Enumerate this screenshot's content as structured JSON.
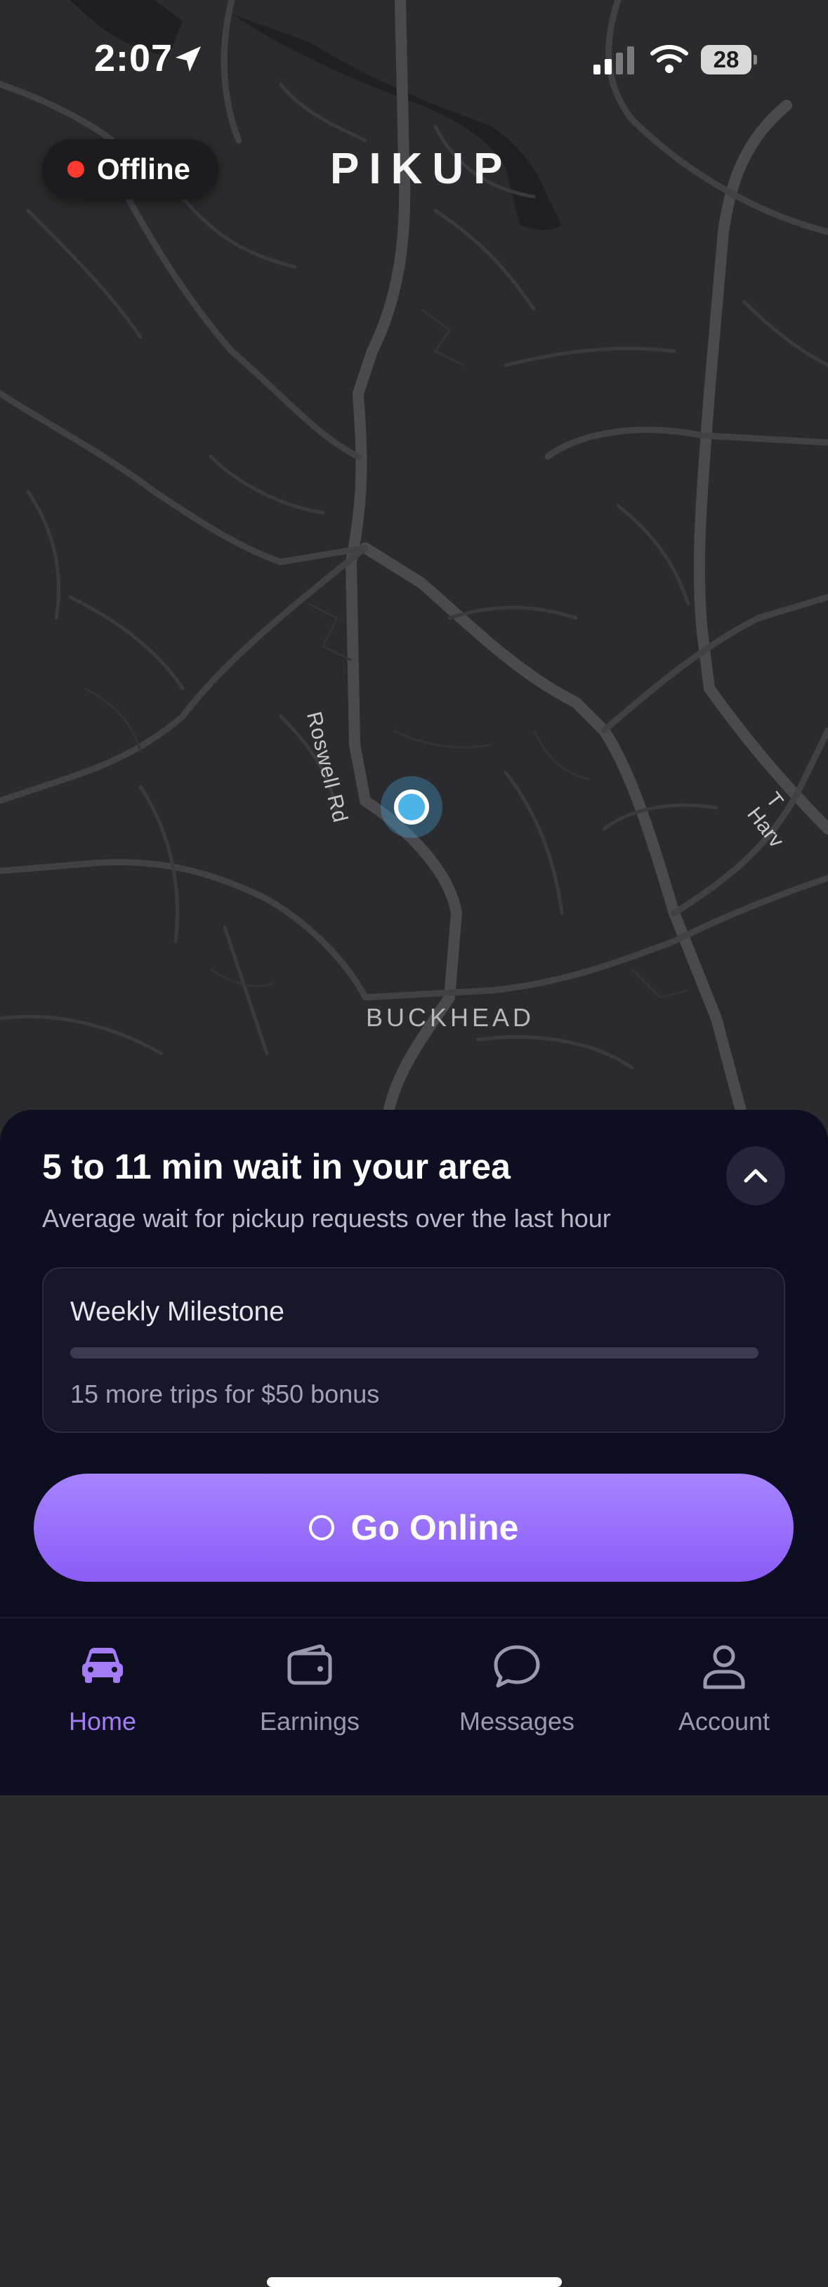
{
  "status_bar": {
    "time": "2:07",
    "battery": "28"
  },
  "header": {
    "status_label": "Offline",
    "status_color": "#ff3b30",
    "logo": "PIKUP"
  },
  "map": {
    "road_label": "Roswell Rd",
    "area_label": "BUCKHEAD",
    "edge_label": "T Harv"
  },
  "sheet": {
    "wait_title": "5 to 11 min wait in your area",
    "wait_subtitle": "Average wait for pickup requests over the last hour",
    "milestone": {
      "title": "Weekly Milestone",
      "progress_fraction": 0,
      "subtitle": "15 more trips for $50 bonus"
    },
    "go_online_label": "Go Online"
  },
  "tabs": [
    {
      "label": "Home",
      "icon": "car-icon",
      "active": true
    },
    {
      "label": "Earnings",
      "icon": "wallet-icon",
      "active": false
    },
    {
      "label": "Messages",
      "icon": "chat-bubble-icon",
      "active": false
    },
    {
      "label": "Account",
      "icon": "person-icon",
      "active": false
    }
  ],
  "colors": {
    "accent": "#8b5cf6",
    "sheet_background": "#0e0e22",
    "map_background": "#2b2b2d"
  }
}
